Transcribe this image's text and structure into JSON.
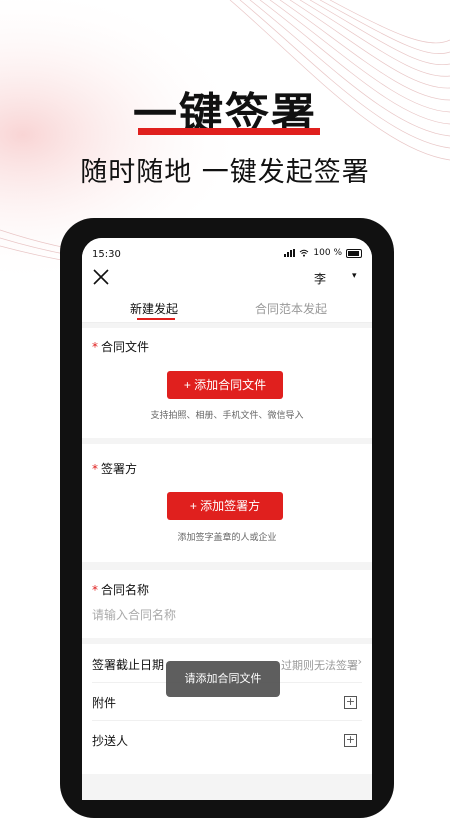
{
  "promo": {
    "headline": "一键签署",
    "subheadline": "随时随地 一键发起签署"
  },
  "status_bar": {
    "time": "15:30",
    "battery": "100 %"
  },
  "nav": {
    "user_name": "李",
    "caret": "▾"
  },
  "tabs": [
    {
      "label": "新建发起",
      "active": true
    },
    {
      "label": "合同范本发起",
      "active": false
    }
  ],
  "contract_file": {
    "title": "合同文件",
    "button": "+ 添加合同文件",
    "hint": "支持拍照、相册、手机文件、微信导入"
  },
  "signers": {
    "title": "签署方",
    "button": "+ 添加签署方",
    "hint": "添加签字盖章的人或企业"
  },
  "contract_name": {
    "title": "合同名称",
    "placeholder": "请输入合同名称"
  },
  "deadline": {
    "label": "签署截止日期",
    "value": "过期则无法签署",
    "chevron": "›"
  },
  "attachment": {
    "label": "附件",
    "icon": "plus-square-icon"
  },
  "cc": {
    "label": "抄送人",
    "icon": "plus-square-icon"
  },
  "required_mark": "*",
  "toast": "请添加合同文件",
  "colors": {
    "accent": "#e0201e",
    "toast_bg": "#505050",
    "text": "#111111",
    "muted": "#999999"
  }
}
